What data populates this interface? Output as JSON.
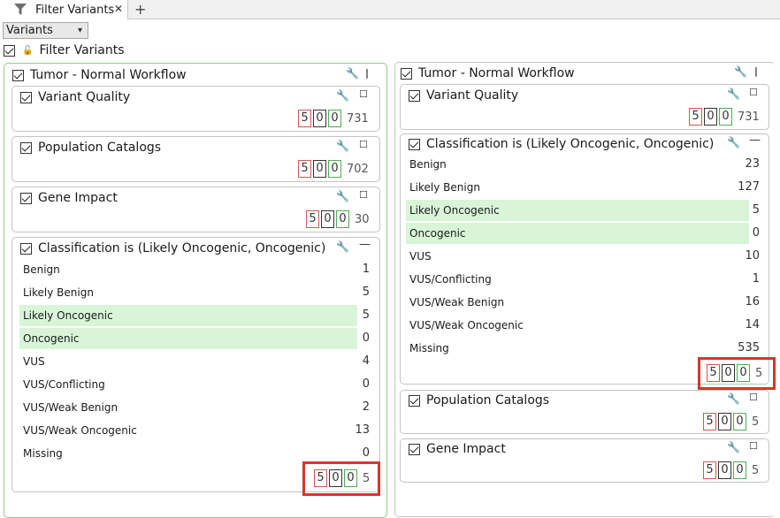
{
  "tab": {
    "label": "Filter Variants",
    "close": "✕",
    "add": "+"
  },
  "select": {
    "value": "Variants"
  },
  "top_filter": {
    "label": "Filter Variants"
  },
  "left": {
    "title": "Tumor - Normal Workflow",
    "variant_quality": {
      "label": "Variant Quality",
      "counts": [
        "5",
        "0",
        "0"
      ],
      "total": "731"
    },
    "population_catalogs": {
      "label": "Population Catalogs",
      "counts": [
        "5",
        "0",
        "0"
      ],
      "total": "702"
    },
    "gene_impact": {
      "label": "Gene Impact",
      "counts": [
        "5",
        "0",
        "0"
      ],
      "total": "30"
    },
    "classification": {
      "label": "Classification is (Likely Oncogenic, Oncogenic)",
      "rows": [
        {
          "label": "Benign",
          "value": "1",
          "selected": false
        },
        {
          "label": "Likely Benign",
          "value": "5",
          "selected": false
        },
        {
          "label": "Likely Oncogenic",
          "value": "5",
          "selected": true
        },
        {
          "label": "Oncogenic",
          "value": "0",
          "selected": true
        },
        {
          "label": "VUS",
          "value": "4",
          "selected": false
        },
        {
          "label": "VUS/Conflicting",
          "value": "0",
          "selected": false
        },
        {
          "label": "VUS/Weak Benign",
          "value": "2",
          "selected": false
        },
        {
          "label": "VUS/Weak Oncogenic",
          "value": "13",
          "selected": false
        },
        {
          "label": "Missing",
          "value": "0",
          "selected": false
        }
      ],
      "counts": [
        "5",
        "0",
        "0"
      ],
      "total": "5"
    }
  },
  "right": {
    "title": "Tumor - Normal Workflow",
    "variant_quality": {
      "label": "Variant Quality",
      "counts": [
        "5",
        "0",
        "0"
      ],
      "total": "731"
    },
    "classification": {
      "label": "Classification is (Likely Oncogenic, Oncogenic)",
      "rows": [
        {
          "label": "Benign",
          "value": "23",
          "selected": false
        },
        {
          "label": "Likely Benign",
          "value": "127",
          "selected": false
        },
        {
          "label": "Likely Oncogenic",
          "value": "5",
          "selected": true
        },
        {
          "label": "Oncogenic",
          "value": "0",
          "selected": true
        },
        {
          "label": "VUS",
          "value": "10",
          "selected": false
        },
        {
          "label": "VUS/Conflicting",
          "value": "1",
          "selected": false
        },
        {
          "label": "VUS/Weak Benign",
          "value": "16",
          "selected": false
        },
        {
          "label": "VUS/Weak Oncogenic",
          "value": "14",
          "selected": false
        },
        {
          "label": "Missing",
          "value": "535",
          "selected": false
        }
      ],
      "counts": [
        "5",
        "0",
        "0"
      ],
      "total": "5"
    },
    "population_catalogs": {
      "label": "Population Catalogs",
      "counts": [
        "5",
        "0",
        "0"
      ],
      "total": "5"
    },
    "gene_impact": {
      "label": "Gene Impact",
      "counts": [
        "5",
        "0",
        "0"
      ],
      "total": "5"
    }
  },
  "colors": {
    "selected_row": "#d8f5d8",
    "highlight_box": "#d9352a",
    "count_red": "#d05a4a",
    "count_green": "#4caf50"
  }
}
